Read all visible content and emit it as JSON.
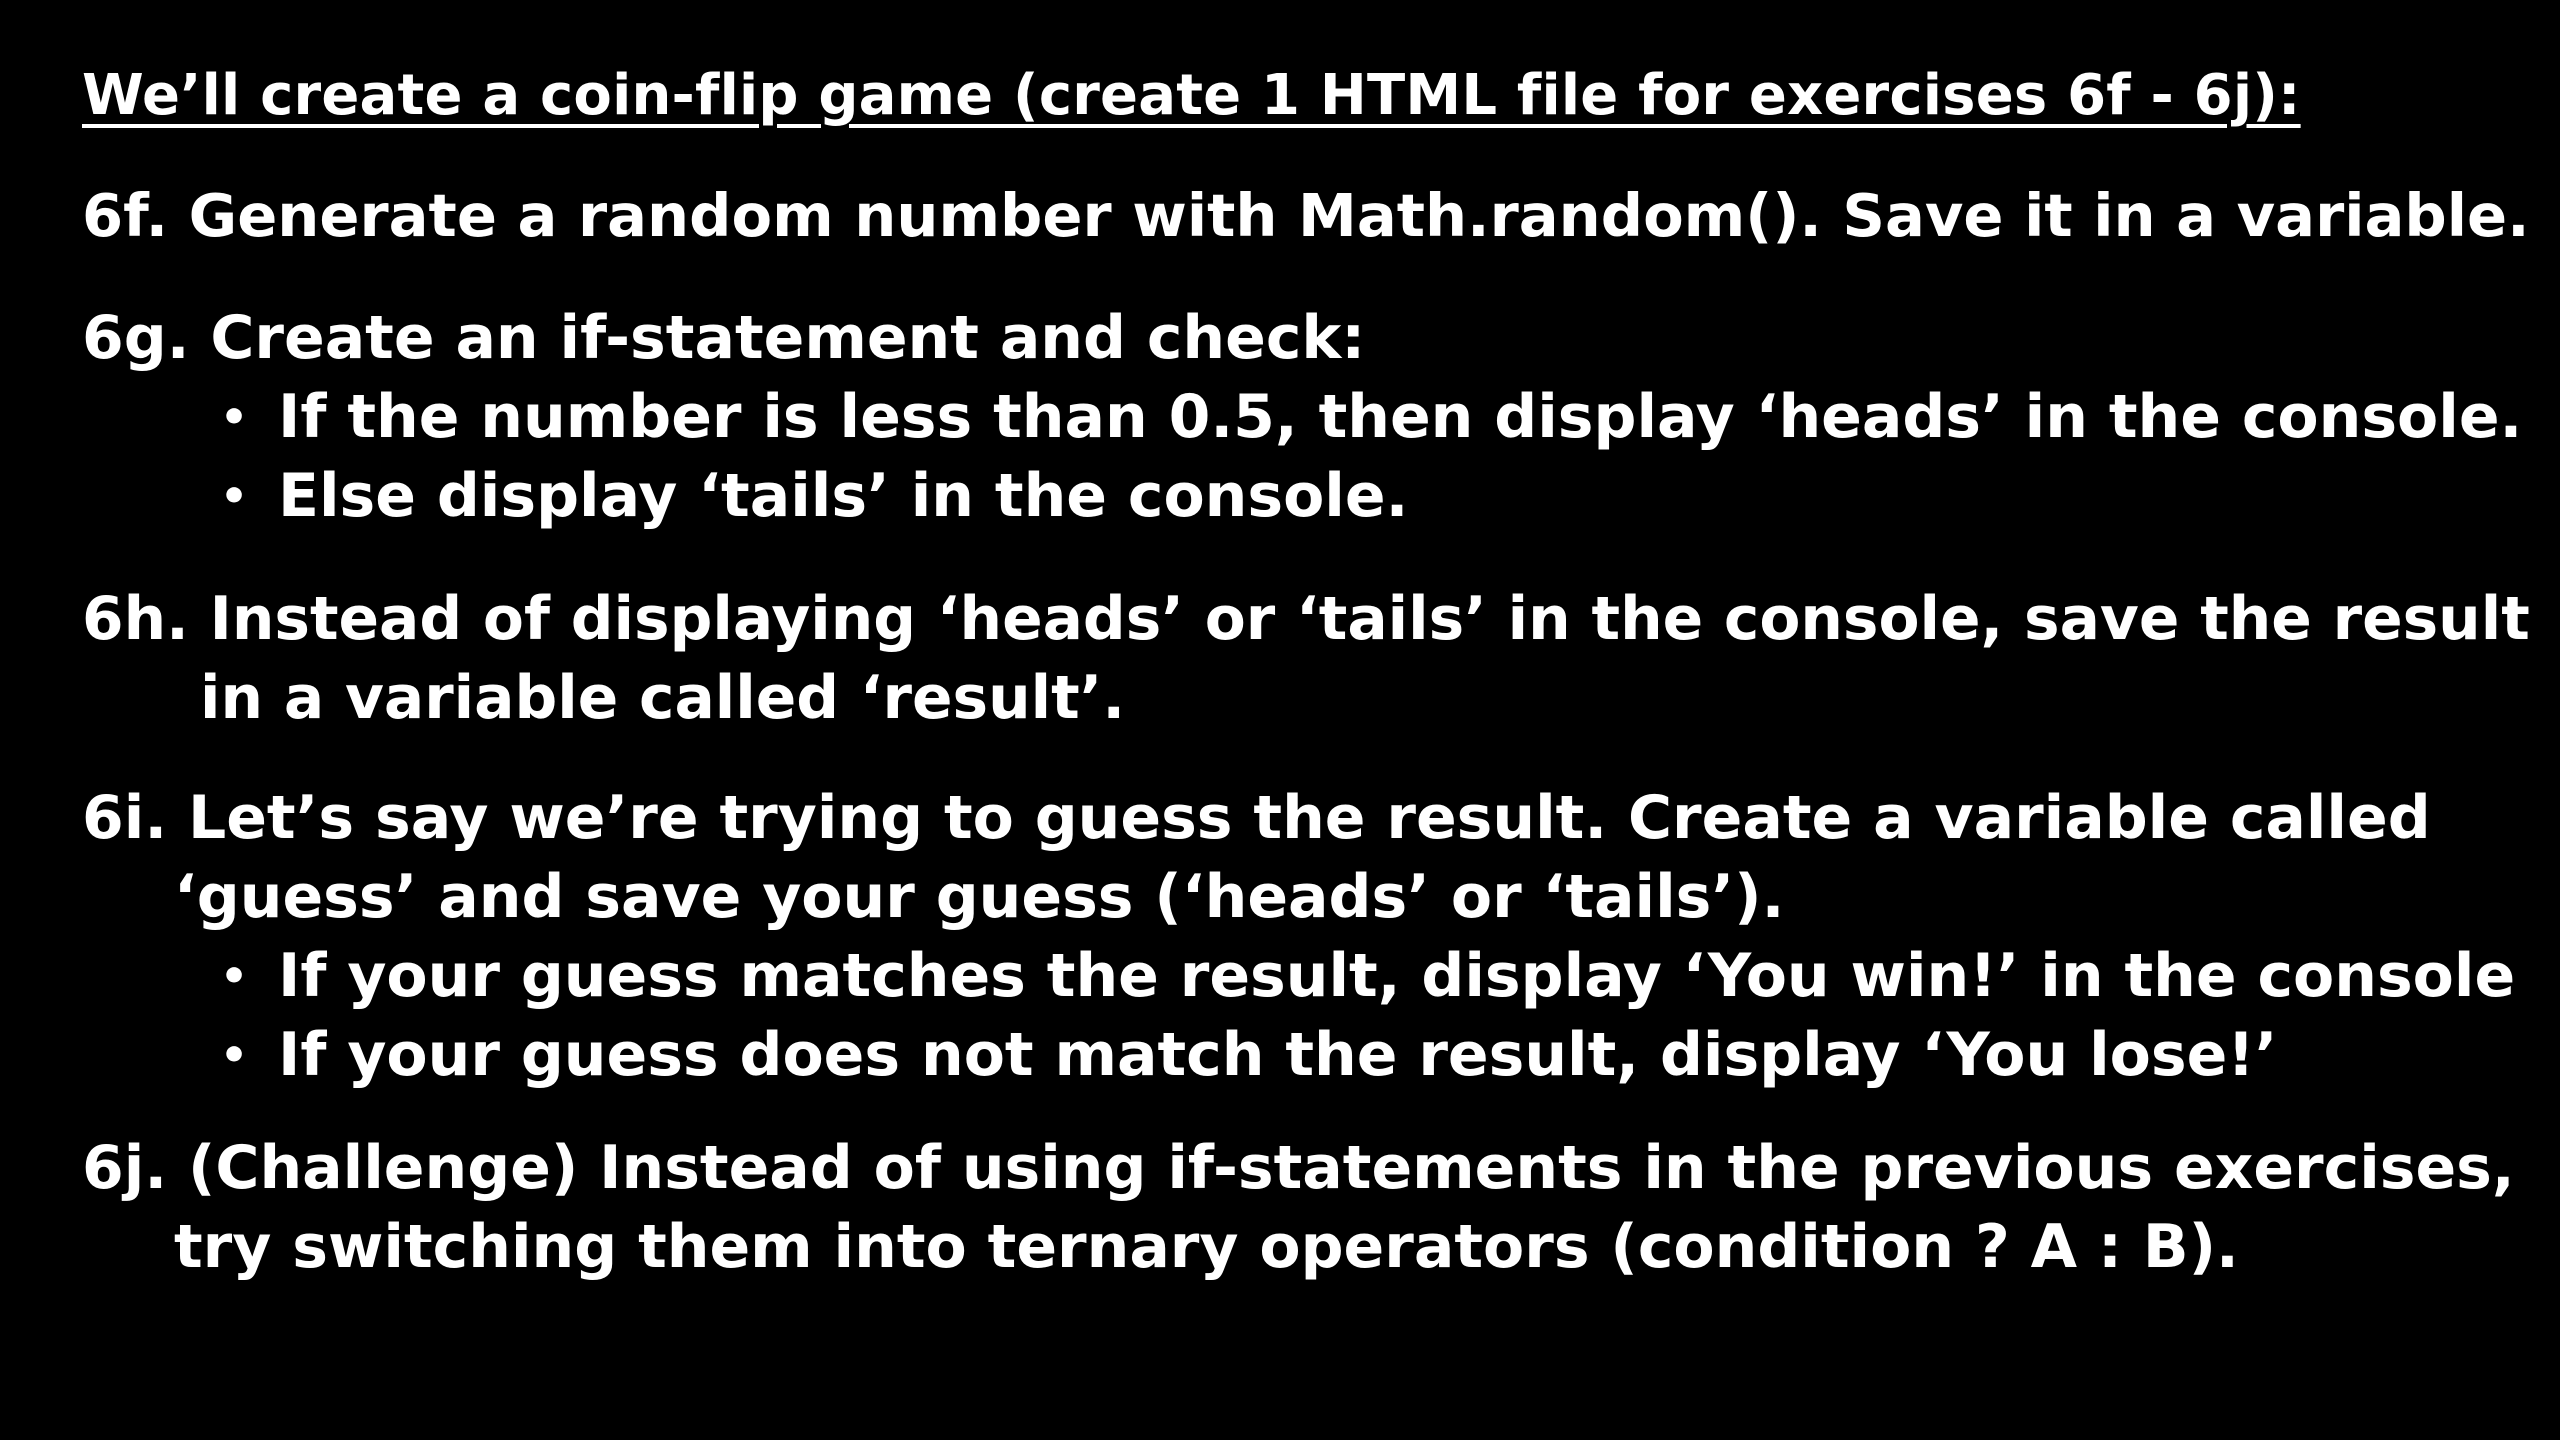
{
  "title": "We’ll create a coin-flip game (create 1 HTML file for exercises 6f - 6j):",
  "ex6f": {
    "text": "6f. Generate a random number with Math.random(). Save it in a variable."
  },
  "ex6g": {
    "text": "6g. Create an if-statement and check:",
    "bullets": [
      "If the number is less than 0.5, then display ‘heads’ in the console.",
      "Else display ‘tails’ in the console."
    ]
  },
  "ex6h": {
    "line1": "6h. Instead of displaying ‘heads’ or ‘tails’ in the console, save the result",
    "line2": "in a variable called ‘result’."
  },
  "ex6i": {
    "line1": "6i. Let’s say we’re trying to guess the result. Create a variable called",
    "line2": "‘guess’ and save your guess (‘heads’ or ‘tails’).",
    "bullets": [
      "If your guess matches the result, display ‘You win!’ in the console",
      "If your guess does not match the result, display ‘You lose!’"
    ]
  },
  "ex6j": {
    "line1": "6j. (Challenge) Instead of using if-statements in the previous exercises,",
    "line2": "try switching them into ternary operators (condition ? A : B)."
  },
  "bullet_glyph": "•"
}
